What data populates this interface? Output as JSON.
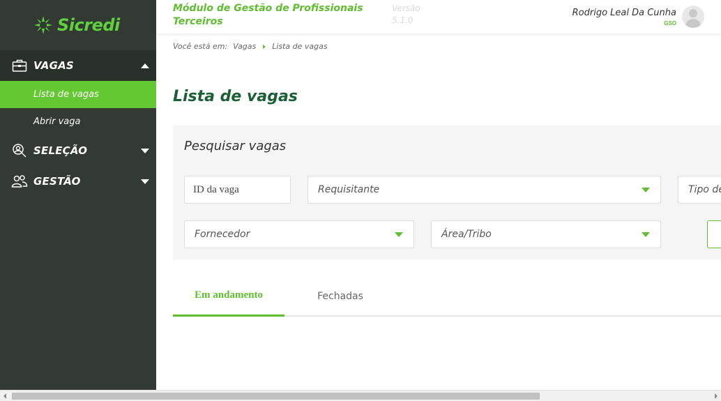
{
  "brand": {
    "name": "Sicredi",
    "color": "#5fd13d"
  },
  "header": {
    "module_title": "Módulo de Gestão de Profissionais Terceiros",
    "version": "Versão 5.1.0",
    "user_name": "Rodrigo Leal Da Cunha",
    "user_role": "GSO"
  },
  "sidebar": {
    "sections": [
      {
        "label": "VAGAS",
        "icon": "briefcase-icon",
        "state": "expanded"
      },
      {
        "label": "SELEÇÃO",
        "icon": "user-search-icon",
        "state": "collapsed"
      },
      {
        "label": "GESTÃO",
        "icon": "users-icon",
        "state": "collapsed"
      }
    ],
    "vagas_items": [
      {
        "label": "Lista de vagas",
        "active": true
      },
      {
        "label": "Abrir vaga",
        "active": false
      }
    ]
  },
  "breadcrumb": {
    "prefix": "Você está em:",
    "items": [
      "Vagas",
      "Lista de vagas"
    ]
  },
  "page_title": "Lista de vagas",
  "search": {
    "title": "Pesquisar vagas",
    "id_placeholder": "ID da vaga",
    "requisitante": "Requisitante",
    "tipo": "Tipo de",
    "fornecedor": "Fornecedor",
    "area": "Área/Tribo"
  },
  "tabs": [
    {
      "label": "Em andamento",
      "active": true
    },
    {
      "label": "Fechadas",
      "active": false
    }
  ],
  "colors": {
    "accent": "#5fbd2f",
    "sidebar": "#323a33",
    "title": "#1b5f35"
  }
}
